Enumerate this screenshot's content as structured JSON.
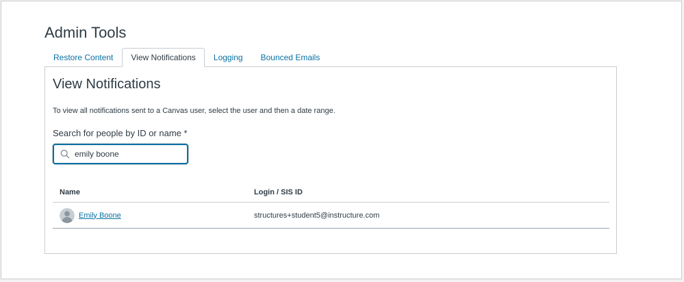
{
  "page": {
    "title": "Admin Tools"
  },
  "tabs": [
    {
      "label": "Restore Content",
      "active": false
    },
    {
      "label": "View Notifications",
      "active": true
    },
    {
      "label": "Logging",
      "active": false
    },
    {
      "label": "Bounced Emails",
      "active": false
    }
  ],
  "panel": {
    "title": "View Notifications",
    "description": "To view all notifications sent to a Canvas user, select the user and then a date range.",
    "search": {
      "label": "Search for people by ID or name *",
      "value": "emily boone",
      "icon": "search-icon"
    },
    "table": {
      "columns": [
        "Name",
        "Login / SIS ID"
      ],
      "rows": [
        {
          "name": "Emily Boone",
          "login": "structures+student5@instructure.com",
          "avatar_icon": "default-avatar-icon"
        }
      ]
    }
  },
  "colors": {
    "link": "#0770a3",
    "text": "#2d3b45",
    "border": "#c7cdd1",
    "focus": "#0770a3"
  }
}
